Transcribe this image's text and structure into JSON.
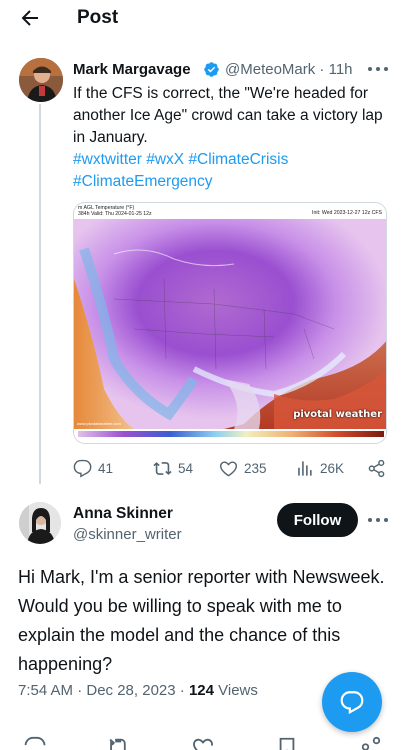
{
  "header": {
    "title": "Post",
    "back_icon": "arrow-left-icon"
  },
  "tweet": {
    "name": "Mark Margavage",
    "handle": "@MeteoMark",
    "separator": "·",
    "time": "11h",
    "text_before": "If the CFS is correct, the \"We're headed for another Ice Age\" crowd can take a victory lap in January.",
    "hashtags": [
      "#wxtwitter",
      "#wxX",
      "#ClimateCrisis",
      "#ClimateEmergency"
    ],
    "map": {
      "header_line1": "m AGL Temperature (°F)",
      "header_line2": "384h Valid: Thu 2024-01-25 12z",
      "header_right": "Init: Wed 2023-12-27 12z CFS",
      "watermark": "pivotal weather",
      "source": "www.pivotalweather.com"
    },
    "actions": {
      "replies": "41",
      "reposts": "54",
      "likes": "235",
      "views": "26K"
    }
  },
  "reply": {
    "name": "Anna Skinner",
    "handle": "@skinner_writer",
    "follow_label": "Follow",
    "text": "Hi Mark, I'm a senior reporter with Newsweek. Would you be willing to speak with me to explain the model and the chance of this happening?",
    "timestamp": "7:54 AM · Dec 28, 2023 · ",
    "views_count": "124",
    "views_label": " Views"
  },
  "colors": {
    "accent": "#1d9bf0",
    "text": "#0f1419",
    "muted": "#536471",
    "verified": "#1d9bf0"
  }
}
